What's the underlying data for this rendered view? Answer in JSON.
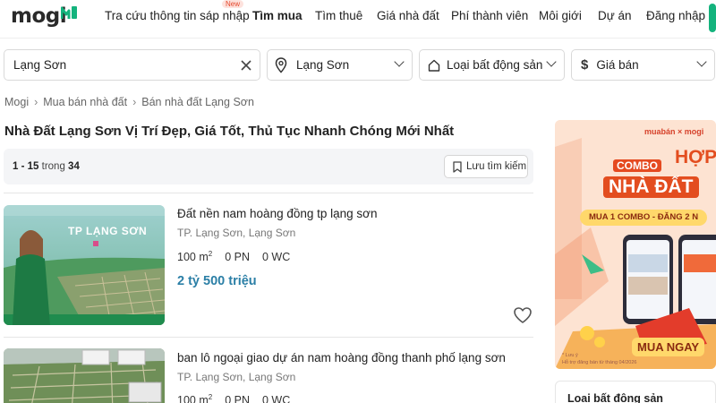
{
  "header": {
    "logo_text": "mogi",
    "nav": [
      {
        "label": "Tra cứu thông tin sáp nhập",
        "badge": "New"
      },
      {
        "label": "Tìm mua"
      },
      {
        "label": "Tìm thuê"
      },
      {
        "label": "Giá nhà đất"
      },
      {
        "label": "Phí thành viên"
      },
      {
        "label": "Môi giới"
      },
      {
        "label": "Dự án"
      },
      {
        "label": "Đăng nhập"
      }
    ]
  },
  "search": {
    "keyword_value": "Lạng Sơn",
    "location_value": "Lạng Sơn",
    "property_type_placeholder": "Loại bất động sản",
    "price_placeholder": "Giá bán"
  },
  "breadcrumb": [
    "Mogi",
    "Mua bán nhà đất",
    "Bán nhà đất Lạng Sơn"
  ],
  "page_title": "Nhà Đất Lạng Sơn Vị Trí Đẹp, Giá Tốt, Thủ Tục Nhanh Chóng Mới Nhất",
  "results": {
    "range": "1 - 15",
    "of_label": "trong",
    "total": "34",
    "save_label": "Lưu tìm kiếm"
  },
  "listings": [
    {
      "title": "Đất nền nam hoàng đồng tp lạng sơn",
      "location": "TP. Lạng Sơn, Lạng Sơn",
      "area": "100 m",
      "area_sup": "2",
      "bedrooms": "0 PN",
      "bathrooms": "0 WC",
      "price": "2 tỷ 500 triệu",
      "thumb_caption": "TP LẠNG SƠN"
    },
    {
      "title": "ban lô ngoại giao dự án nam hoàng đồng thanh phố lạng sơn",
      "location": "TP. Lạng Sơn, Lạng Sơn",
      "area": "100 m",
      "area_sup": "2",
      "bedrooms": "0 PN",
      "bathrooms": "0 WC"
    }
  ],
  "ad": {
    "brand": "muabán × mogi",
    "combo": "COMBO",
    "hop": "HỢP",
    "nha_dat": "NHÀ ĐẤT",
    "offer": "MUA 1 COMBO - ĐĂNG 2 N",
    "cta": "MUA NGAY",
    "note1": "* Lưu ý",
    "note2": "Hỗ trợ đăng bán từ tháng 04/2026"
  },
  "sidebar": {
    "filter_title": "Loại bất động sản"
  },
  "colors": {
    "brand_green": "#14b37d",
    "price_blue": "#2b7fa6",
    "ad_orange": "#e34d1f"
  }
}
